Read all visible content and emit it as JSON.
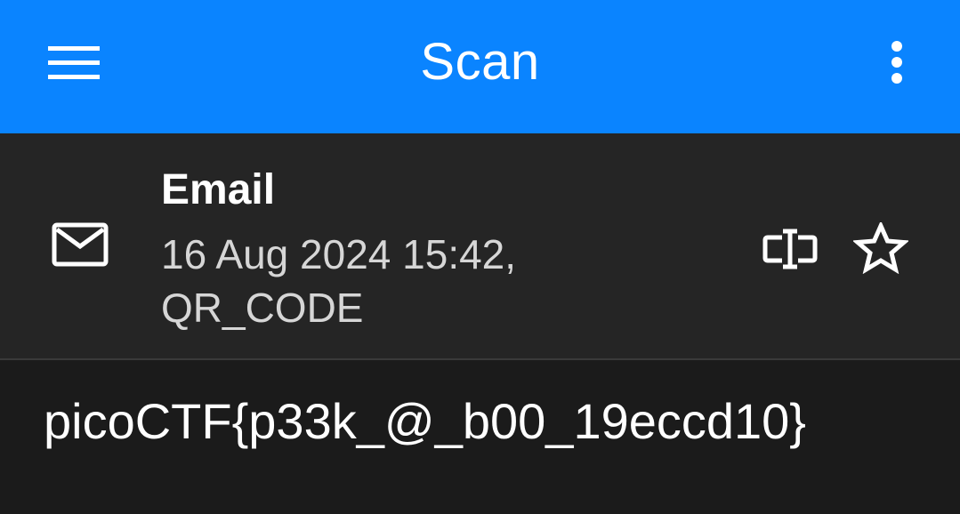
{
  "appbar": {
    "title": "Scan",
    "background": "#0a84ff",
    "menu_icon": "hamburger-menu-icon",
    "more_icon": "more-vertical-icon"
  },
  "result": {
    "type_icon": "email-icon",
    "type": "Email",
    "datetime": "16 Aug 2024 15:42,",
    "format": "QR_CODE",
    "edit_icon": "rename-text-icon",
    "favorite_icon": "star-outline-icon"
  },
  "content": {
    "text": "picoCTF{p33k_@_b00_19eccd10}"
  }
}
